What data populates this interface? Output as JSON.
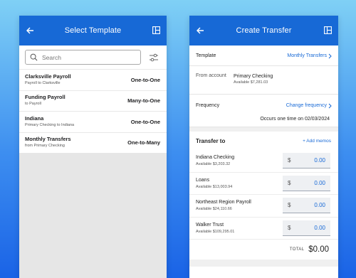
{
  "left_screen": {
    "title": "Select Template",
    "search": {
      "placeholder": "Search"
    },
    "templates": [
      {
        "name": "Clarksville Payroll",
        "subtitle": "Payroll to Clarksville",
        "type": "One-to-One"
      },
      {
        "name": "Funding Payroll",
        "subtitle": "to Payroll",
        "type": "Many-to-One"
      },
      {
        "name": "Indiana",
        "subtitle": "Primary Checking to Indiana",
        "type": "One-to-One"
      },
      {
        "name": "Monthly Transfers",
        "subtitle": "from Primary Checking",
        "type": "One-to-Many"
      }
    ]
  },
  "right_screen": {
    "title": "Create Transfer",
    "template": {
      "label": "Template",
      "value": "Monthly Transfers"
    },
    "from_account": {
      "label": "From account",
      "name": "Primary Checking",
      "available": "Available $7,281.03"
    },
    "frequency": {
      "label": "Frequency",
      "link": "Change frequency",
      "note": "Occurs one time on 02/03/2024"
    },
    "transfer_to": {
      "heading": "Transfer to",
      "add_memos": "+ Add memos",
      "accounts": [
        {
          "name": "Indiana Checking",
          "available": "Available $3,203.32",
          "currency": "$",
          "amount": "0.00"
        },
        {
          "name": "Loans",
          "available": "Available $13,003.94",
          "currency": "$",
          "amount": "0.00"
        },
        {
          "name": "Northeast Region Payroll",
          "available": "Available $24,110.66",
          "currency": "$",
          "amount": "0.00"
        },
        {
          "name": "Walker Trust",
          "available": "Available $109,295.01",
          "currency": "$",
          "amount": "0.00"
        }
      ]
    },
    "total": {
      "label": "TOTAL",
      "value": "$0.00"
    }
  },
  "colors": {
    "brand_blue": "#1769d6",
    "background_top": "#7fd0f5",
    "background_bottom": "#1a63e6"
  },
  "icons": [
    "back-arrow-icon",
    "layout-panels-icon",
    "search-icon",
    "filter-sliders-icon",
    "chevron-right-icon"
  ]
}
